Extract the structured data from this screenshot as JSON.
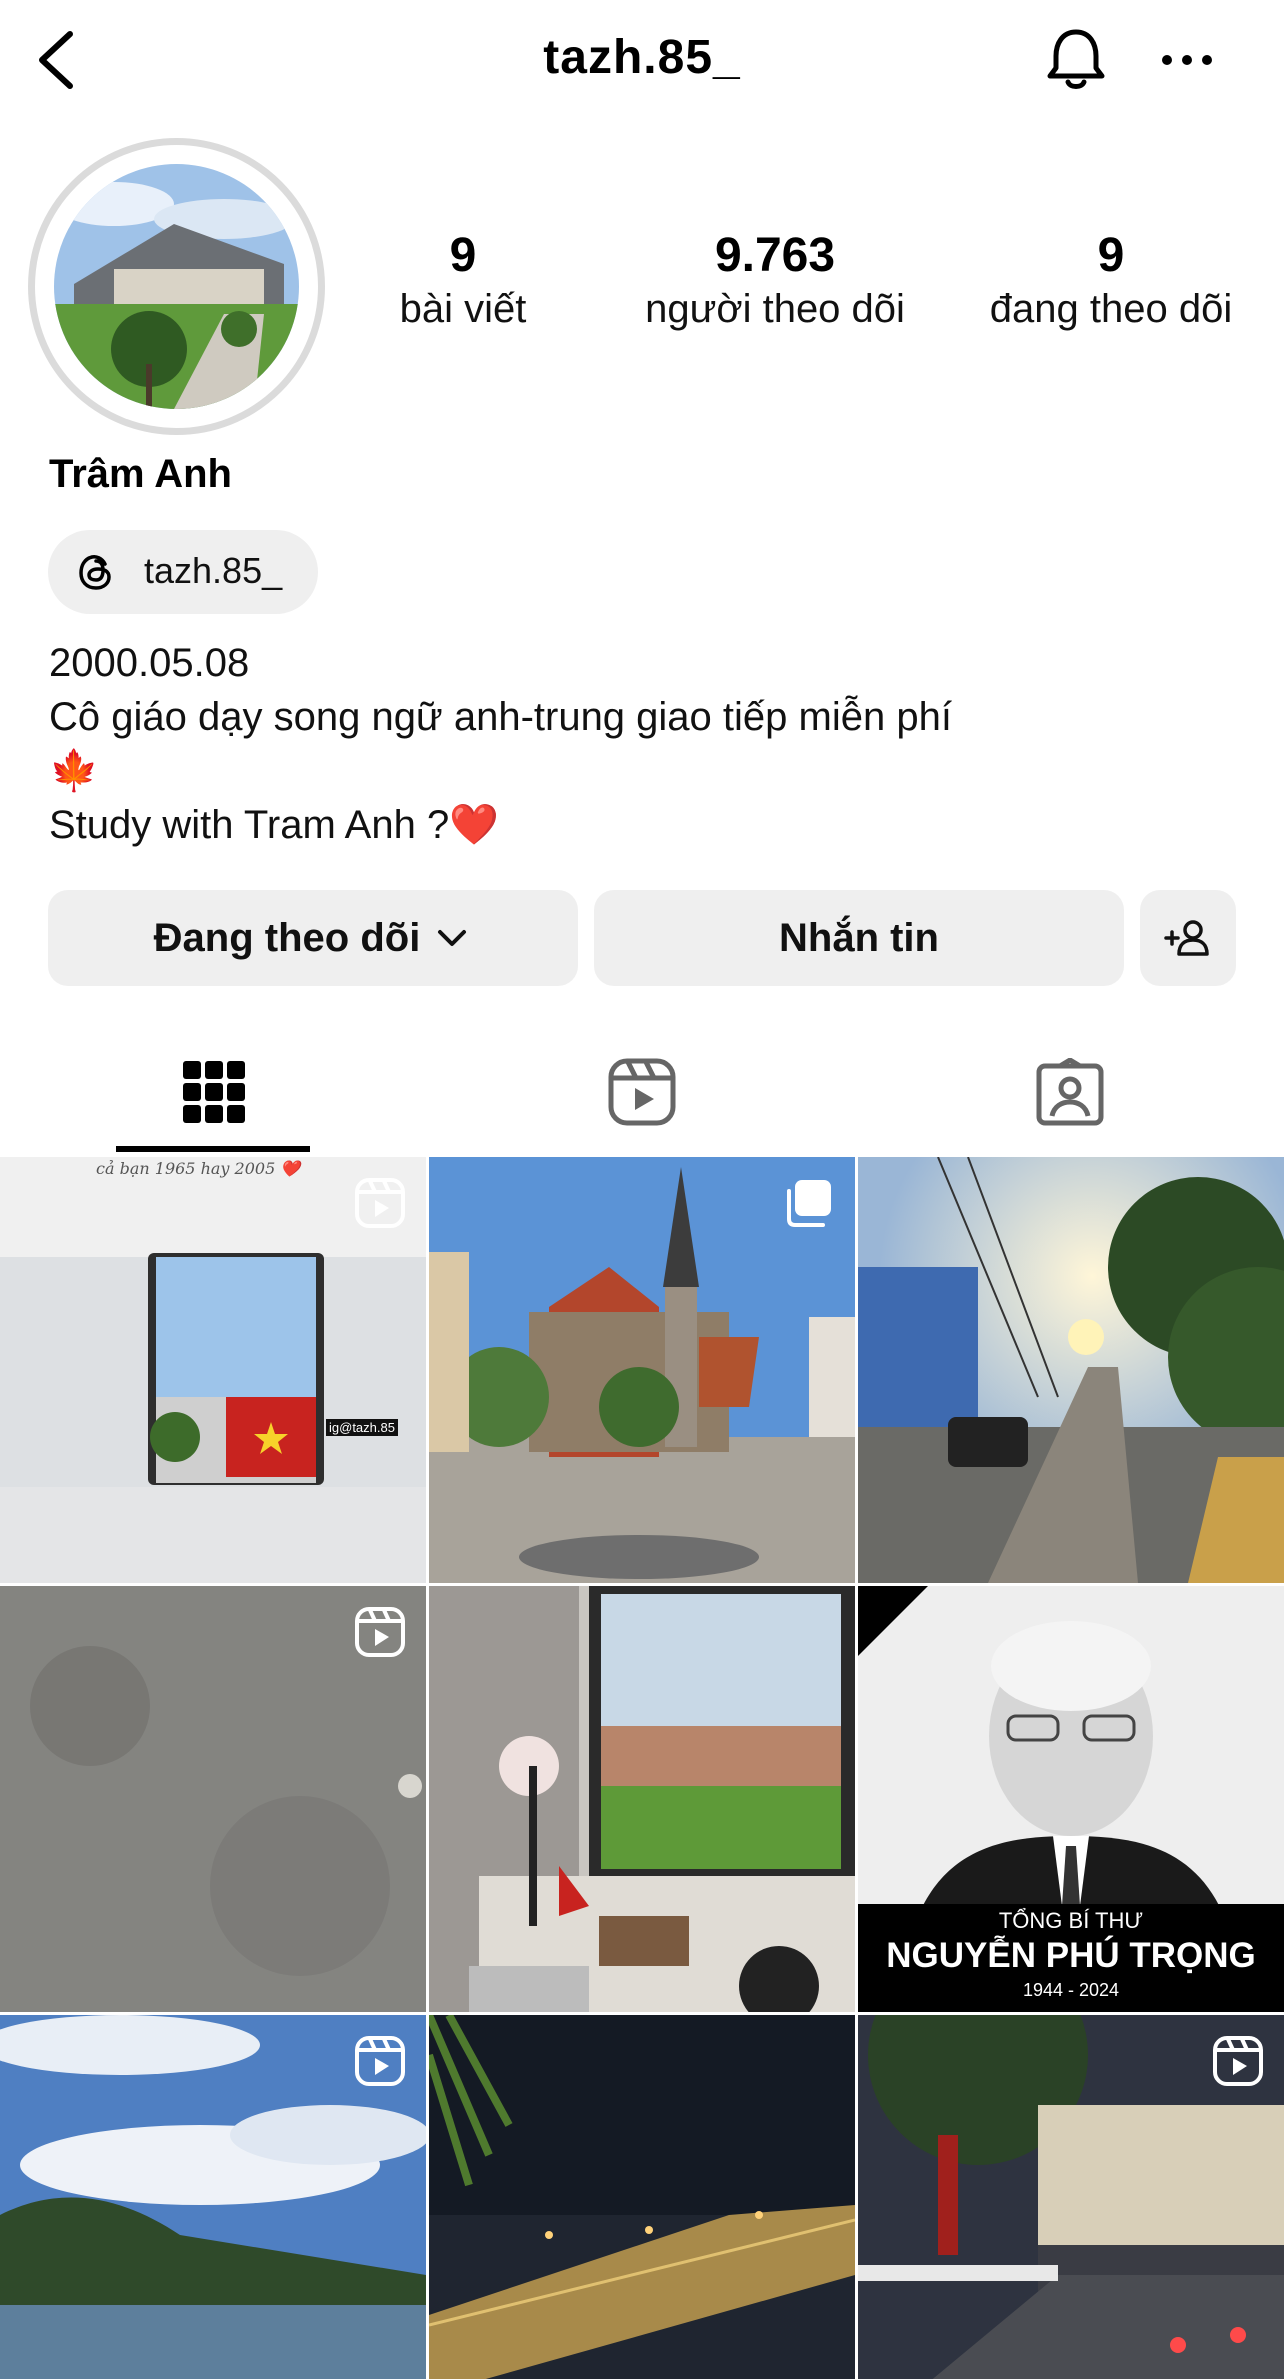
{
  "header": {
    "username": "tazh.85_"
  },
  "profile": {
    "stats": [
      {
        "value": "9",
        "label": "bài viết"
      },
      {
        "value": "9.763",
        "label": "người theo dõi"
      },
      {
        "value": "9",
        "label": "đang theo dõi"
      }
    ],
    "display_name": "Trâm Anh",
    "threads_handle": "tazh.85_",
    "bio": [
      "2000.05.08",
      "Cô giáo dạy song ngữ anh-trung giao tiếp miễn phí",
      "🍁",
      "Study with Tram Anh ?❤️"
    ]
  },
  "actions": {
    "follow_label": "Đang theo dõi",
    "message_label": "Nhắn tin"
  },
  "tabs": [
    "posts-grid",
    "reels",
    "tagged"
  ],
  "posts": [
    {
      "kind": "reel",
      "caption": "cả bạn 1965 hay 2005 ❤️",
      "watermark": "ig@tazh.85"
    },
    {
      "kind": "carousel"
    },
    {
      "kind": "photo"
    },
    {
      "kind": "reel"
    },
    {
      "kind": "photo"
    },
    {
      "kind": "photo",
      "overlay_title": "TỔNG BÍ THƯ",
      "overlay_name": "NGUYỄN PHÚ TRỌNG",
      "overlay_years": "1944 - 2024"
    },
    {
      "kind": "reel"
    },
    {
      "kind": "photo"
    },
    {
      "kind": "reel"
    }
  ],
  "colors": {
    "pill_bg": "#efefef",
    "ring": "#dbdbdb",
    "text": "#000000"
  }
}
